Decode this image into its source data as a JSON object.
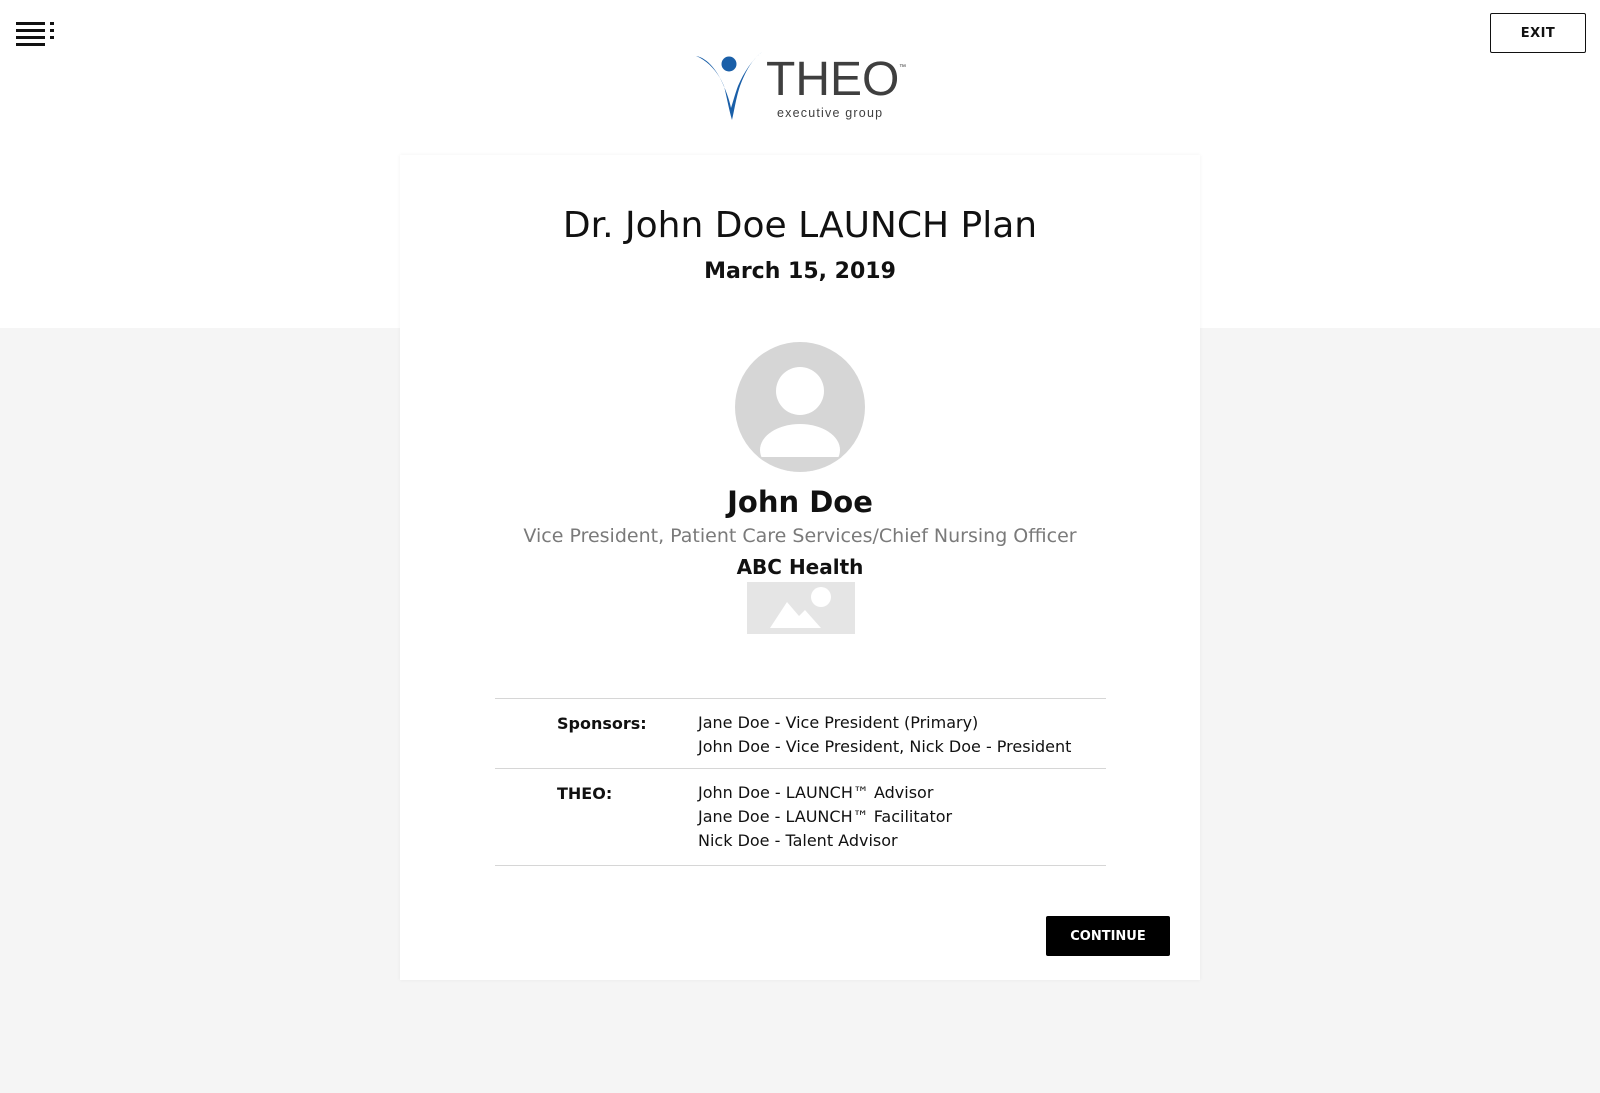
{
  "header": {
    "exit_label": "EXIT",
    "logo": {
      "wordmark": "THEO",
      "trademark": "™",
      "tagline": "executive group",
      "brand_color": "#1a5fa8"
    }
  },
  "plan": {
    "title": "Dr. John Doe LAUNCH Plan",
    "date": "March 15, 2019"
  },
  "profile": {
    "name": "John Doe",
    "role": "Vice President, Patient Care Services/Chief Nursing Officer",
    "organization": "ABC Health"
  },
  "team": [
    {
      "label": "Sponsors:",
      "values": [
        "Jane Doe - Vice President (Primary)",
        "John Doe - Vice President, Nick Doe - President"
      ]
    },
    {
      "label": "THEO:",
      "values": [
        "John Doe - LAUNCH™ Advisor",
        "Jane Doe - LAUNCH™ Facilitator",
        "Nick Doe - Talent Advisor"
      ]
    }
  ],
  "actions": {
    "continue_label": "CONTINUE"
  },
  "colors": {
    "accent": "#000000",
    "page_bg": "#f5f5f5",
    "placeholder": "#d9d9d9",
    "muted_text": "#7a7a7a"
  }
}
